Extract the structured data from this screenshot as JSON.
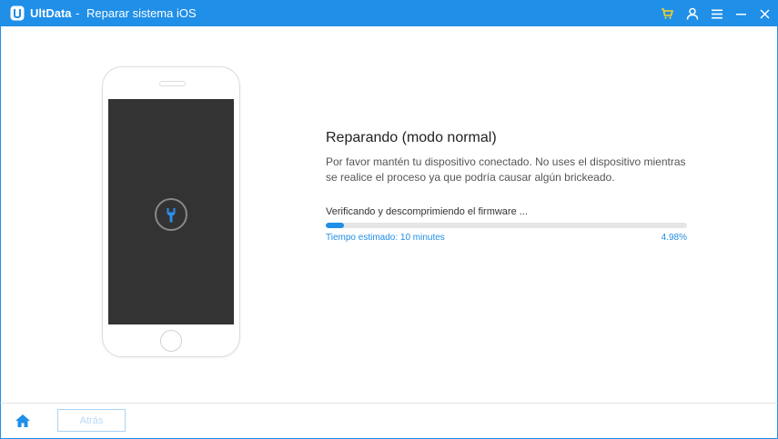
{
  "titlebar": {
    "app_name": "UltData",
    "separator": "-",
    "window_title": "Reparar sistema iOS",
    "icons": [
      "cart-icon",
      "user-icon",
      "menu-icon",
      "minimize-icon",
      "close-icon"
    ]
  },
  "main": {
    "heading": "Reparando (modo normal)",
    "description": "Por favor mantén tu dispositivo conectado. No uses el dispositivo mientras se realice el proceso ya que podría causar algún brickeado.",
    "progress": {
      "step_label": "Verificando y descomprimiendo el firmware ...",
      "eta_label": "Tiempo estimado: 10 minutes",
      "percent_label": "4.98%",
      "fraction": 0.0498
    }
  },
  "footer": {
    "back_label": "Atrás"
  },
  "colors": {
    "accent": "#1f8fe8",
    "phone_screen": "#333333"
  }
}
